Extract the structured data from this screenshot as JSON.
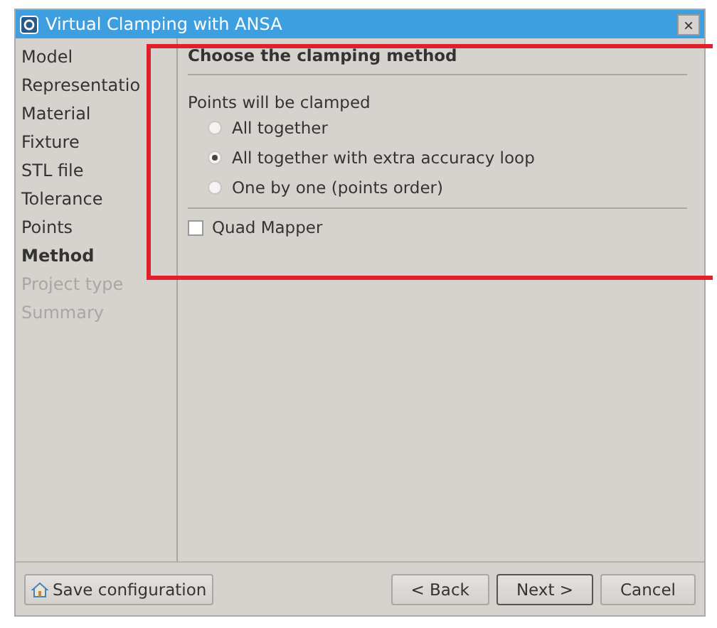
{
  "window": {
    "title": "Virtual Clamping with ANSA",
    "close": "×"
  },
  "sidebar": {
    "items": [
      {
        "label": "Model",
        "selected": false,
        "disabled": false
      },
      {
        "label": "Representatio",
        "selected": false,
        "disabled": false
      },
      {
        "label": "Material",
        "selected": false,
        "disabled": false
      },
      {
        "label": "Fixture",
        "selected": false,
        "disabled": false
      },
      {
        "label": "STL file",
        "selected": false,
        "disabled": false
      },
      {
        "label": "Tolerance",
        "selected": false,
        "disabled": false
      },
      {
        "label": "Points",
        "selected": false,
        "disabled": false
      },
      {
        "label": "Method",
        "selected": true,
        "disabled": false
      },
      {
        "label": "Project type",
        "selected": false,
        "disabled": true
      },
      {
        "label": "Summary",
        "selected": false,
        "disabled": true
      }
    ]
  },
  "page": {
    "heading": "Choose the clamping method",
    "group_label": "Points will be clamped",
    "options": [
      {
        "label": "All together",
        "selected": false
      },
      {
        "label": "All together with extra accuracy loop",
        "selected": true
      },
      {
        "label": "One by one (points order)",
        "selected": false
      }
    ],
    "checkbox": {
      "label": "Quad Mapper",
      "checked": false
    }
  },
  "buttons": [
    {
      "label": "Save configuration",
      "kind": "save",
      "default": false
    },
    {
      "label": "< Back",
      "kind": "nav",
      "default": false
    },
    {
      "label": "Next >",
      "kind": "nav",
      "default": true
    },
    {
      "label": "Cancel",
      "kind": "nav",
      "default": false
    }
  ]
}
